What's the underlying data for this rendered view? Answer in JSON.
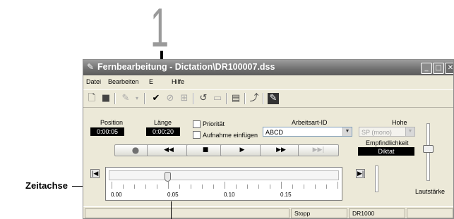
{
  "annotations": {
    "callout_number": "1",
    "timeline_label": "Zeitachse"
  },
  "window": {
    "title": "Fernbearbeitung - Dictation\\DR100007.dss",
    "controls": {
      "minimize": "_",
      "maximize": "□",
      "close": "✕"
    }
  },
  "menu": {
    "items": [
      "Datei",
      "Bearbeiten",
      "E",
      "Hilfe"
    ]
  },
  "toolbar": {
    "icons": [
      "new-document-icon",
      "save-icon",
      "dictate-icon",
      "dropdown-icon",
      "checkmark-icon",
      "disabled-check-icon",
      "book-icon",
      "rewind-edit-icon",
      "document-edit-icon",
      "properties-icon",
      "upload-icon",
      "settings-icon"
    ]
  },
  "fields": {
    "position_label": "Position",
    "position_value": "0:00:05",
    "length_label": "Länge",
    "length_value": "0:00:20",
    "priority_label": "Priorität",
    "insert_label": "Aufnahme einfügen",
    "worktype_label": "Arbeitsart-ID",
    "worktype_value": "ABCD",
    "quality_label": "Hohe",
    "quality_value": "SP (mono)",
    "sensitivity_label": "Empfindlichkeit",
    "sensitivity_value": "Diktat",
    "volume_label": "Lautstärke"
  },
  "transport": {
    "record": "●",
    "rewind": "◀◀",
    "stop": "■",
    "play": "▶",
    "fast_forward": "▶▶",
    "end": "▶▶|"
  },
  "timeline": {
    "ticks": [
      "0.00",
      "0.05",
      "0.10",
      "0.15"
    ],
    "position_fraction": 0.25,
    "start_marker": "|◀",
    "end_marker": "▶|"
  },
  "status": {
    "state": "Stopp",
    "device": "DR1000"
  }
}
